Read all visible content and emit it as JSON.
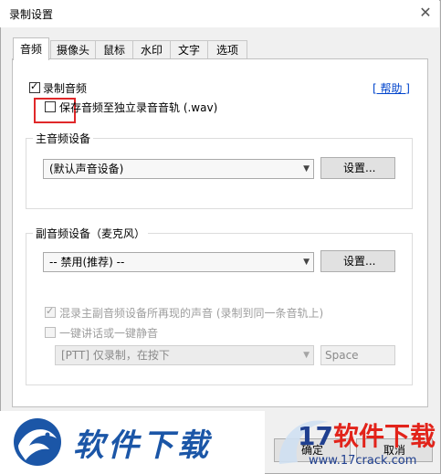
{
  "window": {
    "title": "录制设置",
    "close_glyph": "✕"
  },
  "tabs": [
    {
      "label": "音频",
      "active": true
    },
    {
      "label": "摄像头",
      "active": false
    },
    {
      "label": "鼠标",
      "active": false
    },
    {
      "label": "水印",
      "active": false
    },
    {
      "label": "文字",
      "active": false
    },
    {
      "label": "选项",
      "active": false
    }
  ],
  "audio": {
    "record_audio_label": "录制音频",
    "record_audio_checked": true,
    "help_link": "[ 帮助 ]",
    "save_separate_label": "保存音频至独立录音音轨 (.wav)",
    "save_separate_checked": false,
    "main_group_title": "主音频设备",
    "main_device_value": "(默认声音设备)",
    "main_settings_button": "设置...",
    "sub_group_title": "副音频设备（麦克风）",
    "sub_device_value": "-- 禁用(推荐) --",
    "sub_settings_button": "设置...",
    "mix_label": "混录主副音频设备所再现的声音 (录制到同一条音轨上)",
    "mix_checked": true,
    "ptt_label": "一键讲话或一键静音",
    "ptt_checked": false,
    "ptt_mode_value": "[PTT] 仅录制，在按下",
    "ptt_key_value": "Space"
  },
  "footer": {
    "ok_button": "确定",
    "cancel_button": "取消"
  },
  "watermark": {
    "left_text": "软件下载",
    "brand_number": "17",
    "brand_text": "软件下载",
    "url": "www.17crack.com"
  },
  "colors": {
    "accent_link": "#0044cc",
    "highlight_box": "#e0282a",
    "watermark_blue": "#1b56a7",
    "watermark_red": "#e2231a"
  }
}
